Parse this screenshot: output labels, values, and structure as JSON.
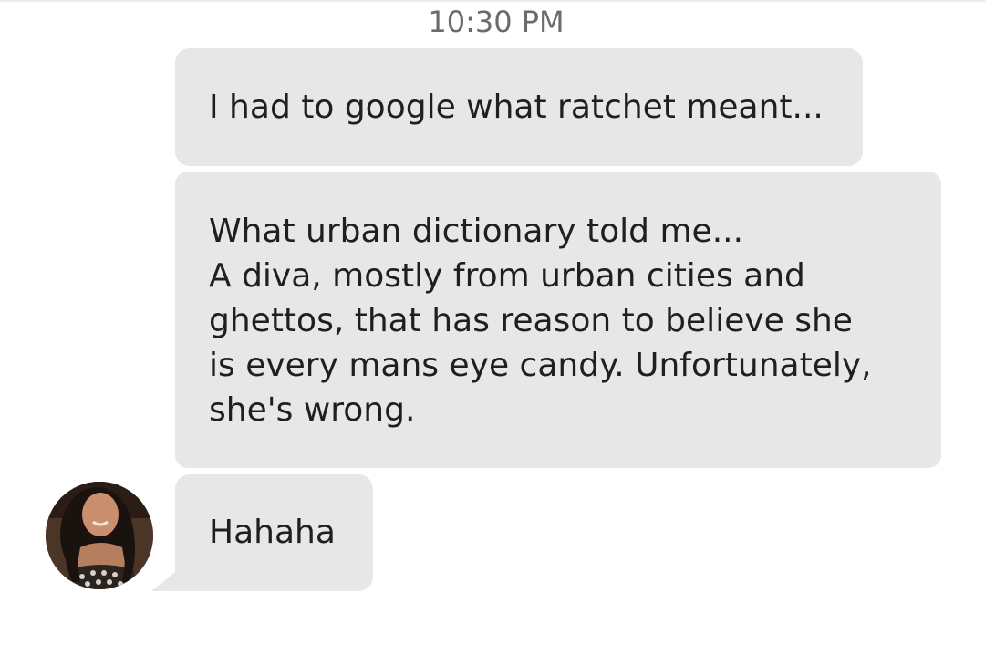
{
  "conversation": {
    "timestamp": "10:30 PM",
    "messages": [
      {
        "sender": "me",
        "text": "I had to google what ratchet meant..."
      },
      {
        "sender": "me",
        "text": "What urban dictionary told me...\nA diva, mostly from urban cities and\nghettos, that has reason to believe she\nis every mans eye candy. Unfortunately,\nshe's wrong."
      },
      {
        "sender": "contact",
        "text": "Hahaha"
      }
    ]
  },
  "colors": {
    "bubble": "#e7e7e7",
    "timestamp": "#6b6b6b",
    "text": "#1f1f1f",
    "background": "#ffffff"
  }
}
